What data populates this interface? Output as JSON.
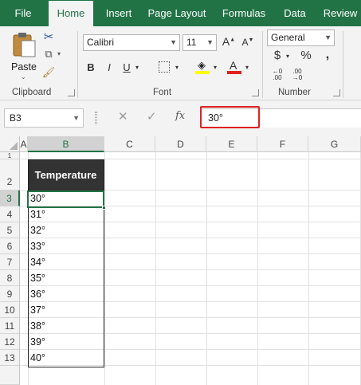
{
  "tabs": [
    {
      "label": "File",
      "active": false
    },
    {
      "label": "Home",
      "active": true
    },
    {
      "label": "Insert",
      "active": false
    },
    {
      "label": "Page Layout",
      "active": false
    },
    {
      "label": "Formulas",
      "active": false
    },
    {
      "label": "Data",
      "active": false
    },
    {
      "label": "Review",
      "active": false
    }
  ],
  "ribbon": {
    "clipboard": {
      "label": "Clipboard",
      "paste_label": "Paste"
    },
    "font": {
      "label": "Font",
      "font_name": "Calibri",
      "font_size": "11",
      "bold": "B",
      "italic": "I",
      "underline": "U"
    },
    "number": {
      "label": "Number",
      "format": "General"
    }
  },
  "formula_bar": {
    "name_box": "B3",
    "fx": "fx",
    "value": "30°"
  },
  "columns": [
    "A",
    "B",
    "C",
    "D",
    "E",
    "F",
    "G"
  ],
  "rows": [
    "1",
    "2",
    "3",
    "4",
    "5",
    "6",
    "7",
    "8",
    "9",
    "10",
    "11",
    "12",
    "13"
  ],
  "selected_cell": "B3",
  "table": {
    "header": "Temperature",
    "values": [
      "30°",
      "31°",
      "32°",
      "33°",
      "34°",
      "35°",
      "36°",
      "37°",
      "38°",
      "39°",
      "40°"
    ]
  },
  "colors": {
    "accent": "#217346",
    "highlight": "#e02020",
    "header_fill": "#333333"
  }
}
